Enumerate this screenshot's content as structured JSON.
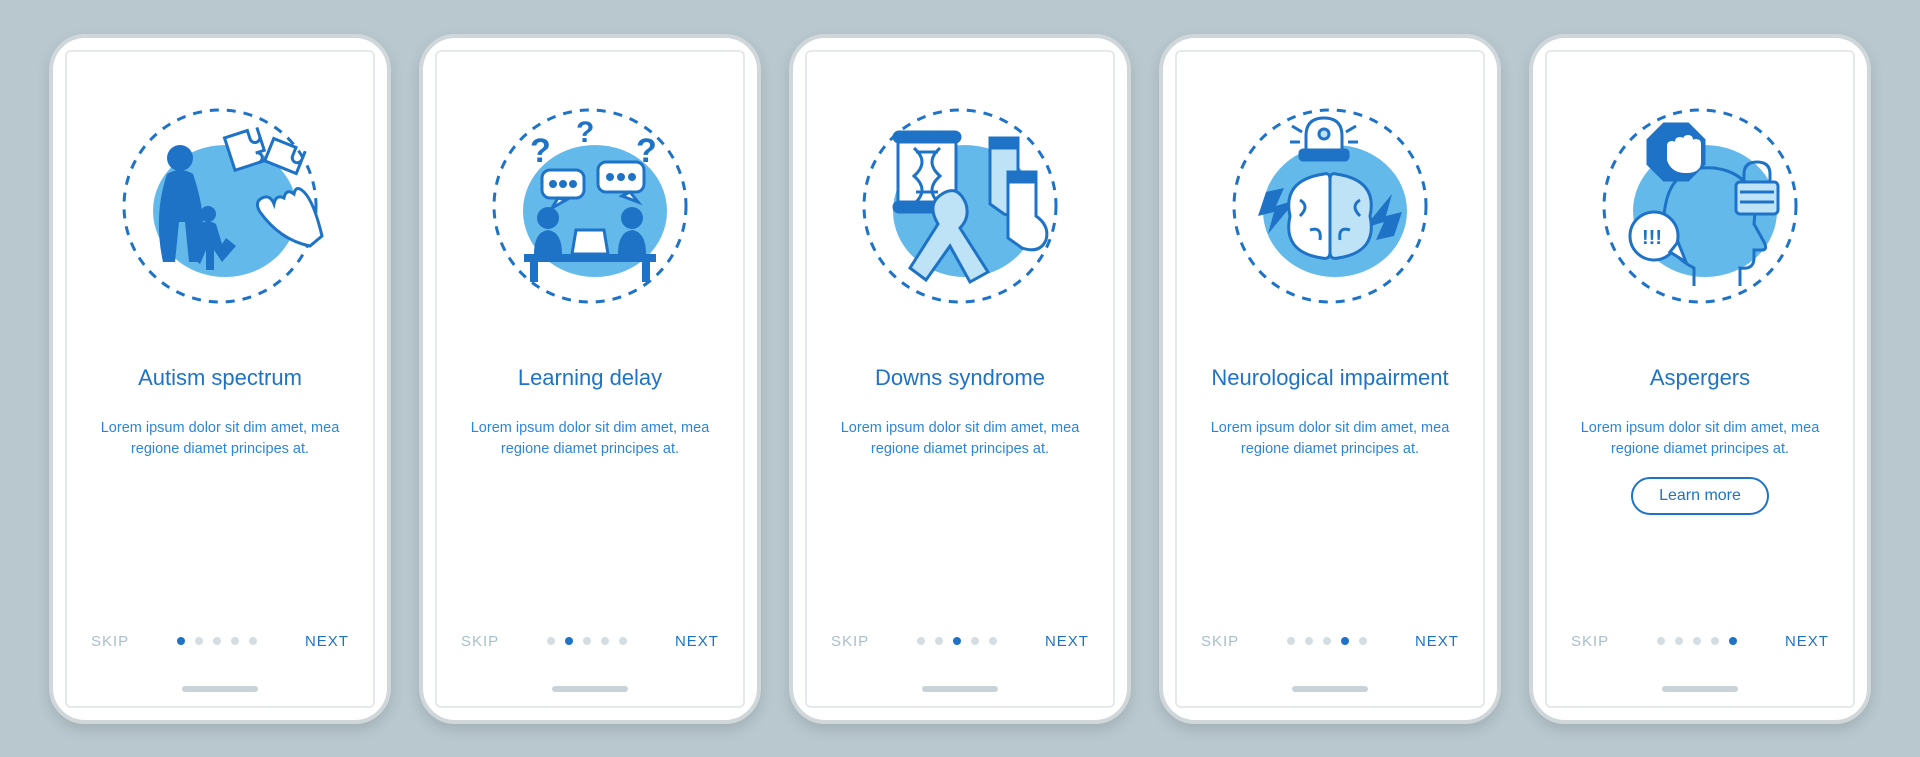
{
  "colors": {
    "primary": "#1e73c7",
    "light": "#63b9ea",
    "muted": "#a8bfcb"
  },
  "common": {
    "skip": "SKIP",
    "next": "NEXT",
    "learn_more": "Learn more",
    "desc": "Lorem ipsum dolor sit dim amet, mea regione diamet principes at."
  },
  "screens": [
    {
      "title": "Autism spectrum",
      "icon": "autism-icon",
      "active": 0,
      "learn_more": false
    },
    {
      "title": "Learning delay",
      "icon": "learning-delay-icon",
      "active": 1,
      "learn_more": false
    },
    {
      "title": "Downs syndrome",
      "icon": "downs-syndrome-icon",
      "active": 2,
      "learn_more": false
    },
    {
      "title": "Neurological impairment",
      "icon": "neurological-impairment-icon",
      "active": 3,
      "learn_more": false
    },
    {
      "title": "Aspergers",
      "icon": "aspergers-icon",
      "active": 4,
      "learn_more": true
    }
  ]
}
